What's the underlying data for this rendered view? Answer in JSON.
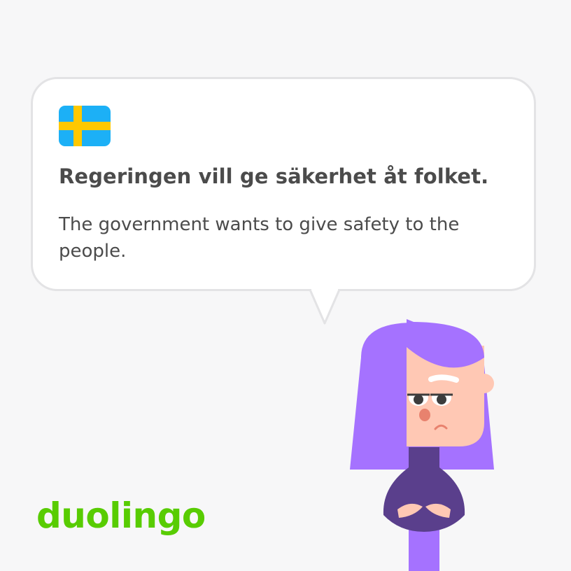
{
  "card": {
    "sentence": "Regeringen vill ge säkerhet åt folket.",
    "translation": "The government wants to give safety to the people."
  },
  "flag": {
    "icon": "sweden-flag-icon",
    "blue": "#1cb0f6",
    "yellow": "#ffc800"
  },
  "brand": {
    "logo_text": "duolingo",
    "color": "#58cc02"
  },
  "character": {
    "icon": "lily-character-icon",
    "hair": "#a572ff",
    "shirt": "#5a3f8c",
    "skin": "#ffc8b4"
  }
}
